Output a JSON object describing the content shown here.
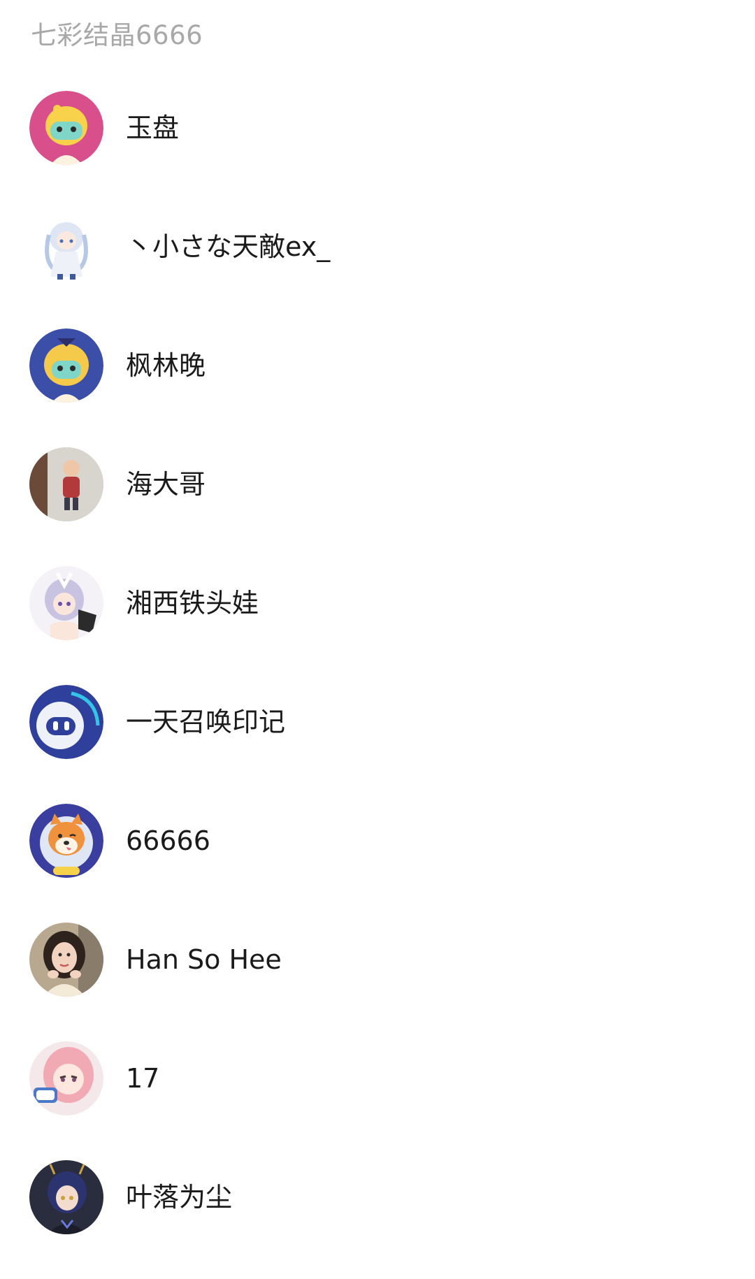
{
  "group": {
    "title": "七彩结晶6666"
  },
  "members": [
    {
      "name": "玉盘",
      "avatar": "anime-mascot-pink-icon"
    },
    {
      "name": "丶小さな天敵ex_",
      "avatar": "anime-girl-white-icon"
    },
    {
      "name": "枫林晚",
      "avatar": "anime-mascot-blue-icon"
    },
    {
      "name": "海大哥",
      "avatar": "toddler-photo-icon"
    },
    {
      "name": "湘西铁头娃",
      "avatar": "anime-girl-silver-icon"
    },
    {
      "name": "一天召唤印记",
      "avatar": "robot-face-icon"
    },
    {
      "name": "66666",
      "avatar": "shiba-dog-icon"
    },
    {
      "name": "Han So Hee",
      "avatar": "woman-photo-icon"
    },
    {
      "name": "17",
      "avatar": "anime-girl-pink-hair-icon"
    },
    {
      "name": "叶落为尘",
      "avatar": "anime-boy-dark-icon"
    }
  ]
}
